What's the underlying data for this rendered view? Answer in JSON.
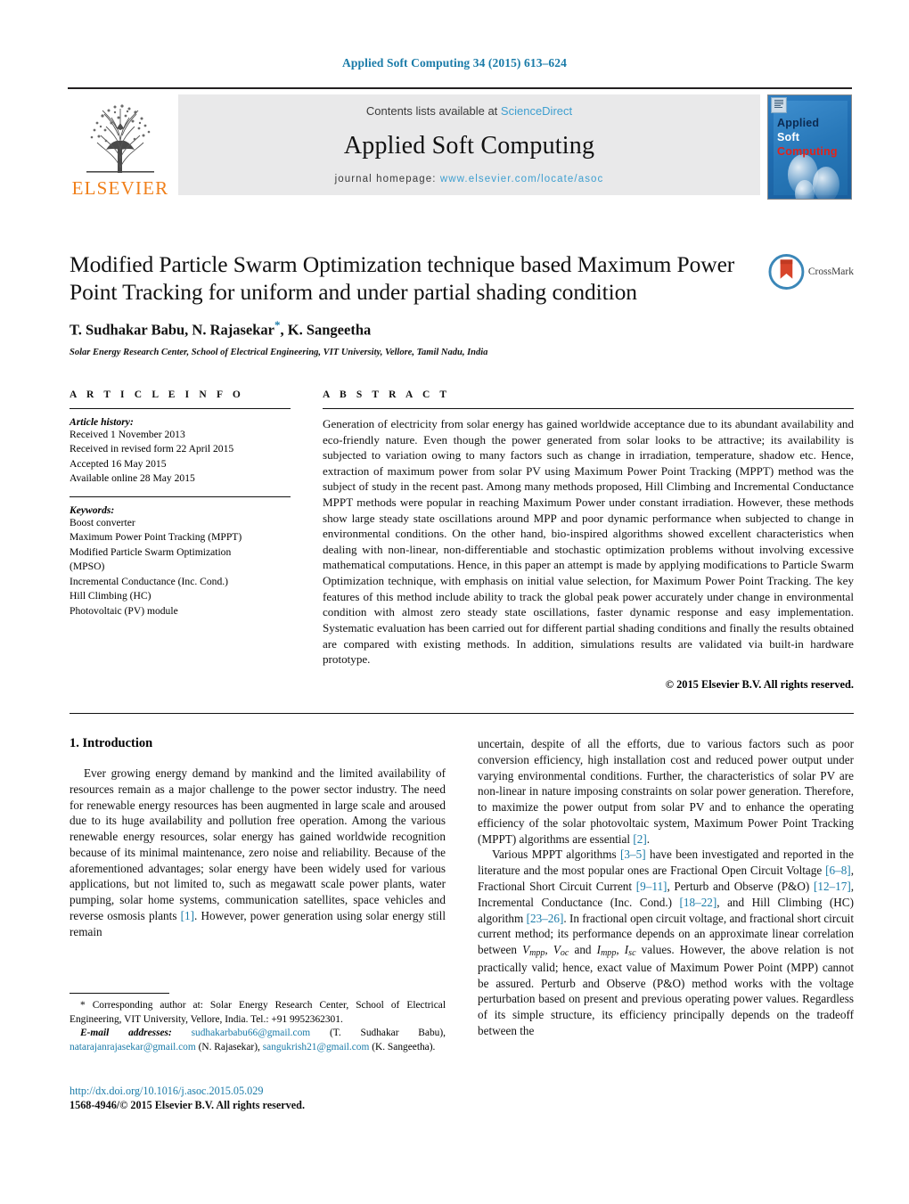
{
  "running_head": "Applied Soft Computing 34 (2015) 613–624",
  "masthead": {
    "publisher_name": "ELSEVIER",
    "contents_prefix": "Contents lists available at",
    "contents_link": "ScienceDirect",
    "journal_title": "Applied Soft Computing",
    "homepage_prefix": "journal homepage:",
    "homepage_url": "www.elsevier.com/locate/asoc",
    "cover": {
      "line1": "Applied",
      "line2": "Soft",
      "line3": "Computing"
    }
  },
  "article": {
    "title": "Modified Particle Swarm Optimization technique based Maximum Power Point Tracking for uniform and under partial shading condition",
    "crossmark_label": "CrossMark",
    "authors": "T. Sudhakar Babu, N. Rajasekar",
    "authors_tail": ", K. Sangeetha",
    "affiliation": "Solar Energy Research Center, School of Electrical Engineering, VIT University, Vellore, Tamil Nadu, India"
  },
  "article_info": {
    "heading": "A R T I C L E   I N F O",
    "history_label": "Article history:",
    "history": [
      "Received 1 November 2013",
      "Received in revised form 22 April 2015",
      "Accepted 16 May 2015",
      "Available online 28 May 2015"
    ],
    "keywords_label": "Keywords:",
    "keywords": [
      "Boost converter",
      "Maximum Power Point Tracking (MPPT)",
      "Modified Particle Swarm Optimization",
      "(MPSO)",
      "Incremental Conductance (Inc. Cond.)",
      "Hill Climbing (HC)",
      "Photovoltaic (PV) module"
    ]
  },
  "abstract": {
    "heading": "A B S T R A C T",
    "text": "Generation of electricity from solar energy has gained worldwide acceptance due to its abundant availability and eco-friendly nature. Even though the power generated from solar looks to be attractive; its availability is subjected to variation owing to many factors such as change in irradiation, temperature, shadow etc. Hence, extraction of maximum power from solar PV using Maximum Power Point Tracking (MPPT) method was the subject of study in the recent past. Among many methods proposed, Hill Climbing and Incremental Conductance MPPT methods were popular in reaching Maximum Power under constant irradiation. However, these methods show large steady state oscillations around MPP and poor dynamic performance when subjected to change in environmental conditions. On the other hand, bio-inspired algorithms showed excellent characteristics when dealing with non-linear, non-differentiable and stochastic optimization problems without involving excessive mathematical computations. Hence, in this paper an attempt is made by applying modifications to Particle Swarm Optimization technique, with emphasis on initial value selection, for Maximum Power Point Tracking. The key features of this method include ability to track the global peak power accurately under change in environmental condition with almost zero steady state oscillations, faster dynamic response and easy implementation. Systematic evaluation has been carried out for different partial shading conditions and finally the results obtained are compared with existing methods. In addition, simulations results are validated via built-in hardware prototype.",
    "copyright": "© 2015 Elsevier B.V. All rights reserved."
  },
  "body": {
    "section_heading": "1.  Introduction",
    "left_para_1": "Ever growing energy demand by mankind and the limited availability of resources remain as a major challenge to the power sector industry. The need for renewable energy resources has been augmented in large scale and aroused due to its huge availability and pollution free operation. Among the various renewable energy resources, solar energy has gained worldwide recognition because of its minimal maintenance, zero noise and reliability. Because of the aforementioned advantages; solar energy have been widely used for various applications, but not limited to, such as megawatt scale power plants, water pumping, solar home systems, communication satellites, space vehicles and reverse osmosis plants",
    "left_ref_1": "[1]",
    "left_para_1_tail": ". However, power generation using solar energy still remain",
    "right_para_1": "uncertain, despite of all the efforts, due to various factors such as poor conversion efficiency, high installation cost and reduced power output under varying environmental conditions. Further, the characteristics of solar PV are non-linear in nature imposing constraints on solar power generation. Therefore, to maximize the power output from solar PV and to enhance the operating efficiency of the solar photovoltaic system, Maximum Power Point Tracking (MPPT) algorithms are essential",
    "right_ref_1": "[2]",
    "right_para_1_tail": ".",
    "right_para_2_a": "Various MPPT algorithms",
    "right_ref_2": "[3–5]",
    "right_para_2_b": "have been investigated and reported in the literature and the most popular ones are Fractional Open Circuit Voltage",
    "right_ref_3": "[6–8]",
    "right_para_2_c": ", Fractional Short Circuit Current",
    "right_ref_4": "[9–11]",
    "right_para_2_d": ", Perturb and Observe (P&O)",
    "right_ref_5": "[12–17]",
    "right_para_2_e": ", Incremental Conductance (Inc. Cond.)",
    "right_ref_6": "[18–22]",
    "right_para_2_f": ", and Hill Climbing (HC) algorithm",
    "right_ref_7": "[23–26]",
    "right_para_2_g": ". In fractional open circuit voltage, and fractional short circuit current method; its performance depends on an approximate linear correlation between",
    "sym_vmpp": "V",
    "sym_vmpp_sub": "mpp",
    "sym_voc": "V",
    "sym_voc_sub": "oc",
    "sym_impp": "I",
    "sym_impp_sub": "mpp",
    "sym_isc": "I",
    "sym_isc_sub": "sc",
    "right_para_2_h": "values. However, the above relation is not practically valid; hence, exact value of Maximum Power Point (MPP) cannot be assured. Perturb and Observe (P&O) method works with the voltage perturbation based on present and previous operating power values. Regardless of its simple structure, its efficiency principally depends on the tradeoff between the"
  },
  "footnote": {
    "corresponding": "* Corresponding author at: Solar Energy Research Center, School of Electrical Engineering, VIT University, Vellore, India. Tel.: +91 9952362301.",
    "email_label": "E-mail addresses:",
    "email1": "sudhakarbabu66@gmail.com",
    "email1_name": "(T. Sudhakar Babu),",
    "email2": "natarajanrajasekar@gmail.com",
    "email2_name": "(N. Rajasekar),",
    "email3": "sangukrish21@gmail.com",
    "email3_name": "(K. Sangeetha).",
    "doi": "http://dx.doi.org/10.1016/j.asoc.2015.05.029",
    "issn": "1568-4946/© 2015 Elsevier B.V. All rights reserved."
  },
  "colors": {
    "link_blue": "#1a7ba8",
    "sciencedirect_blue": "#3e9fd0",
    "elsevier_orange": "#f07f1a",
    "cover_blue": "#2878b9",
    "cover_red": "#e2231a",
    "band_grey": "#e9e9ea"
  }
}
